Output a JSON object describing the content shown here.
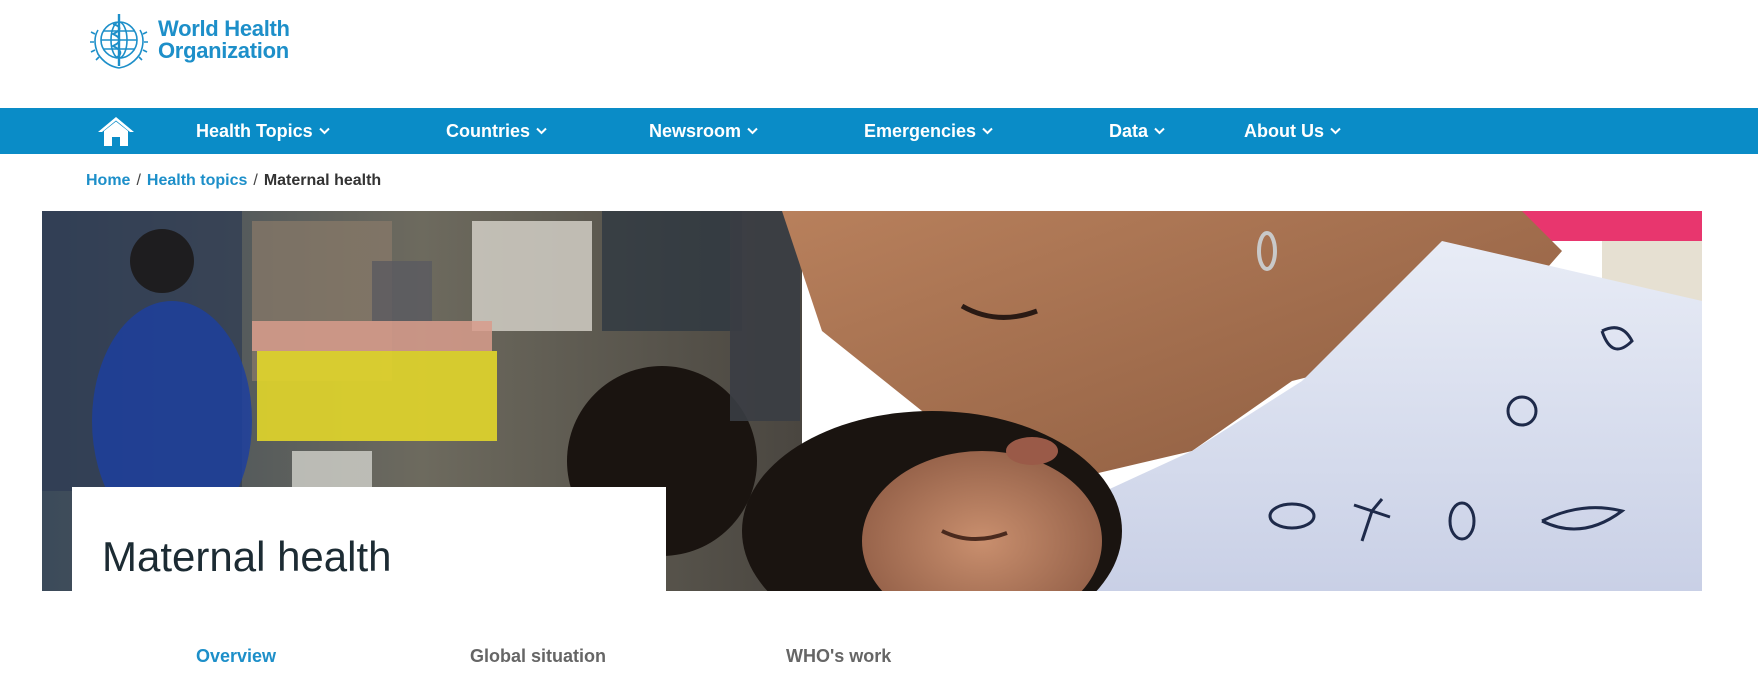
{
  "header": {
    "logo": {
      "line1": "World Health",
      "line2": "Organization",
      "icon": "who-emblem-icon"
    }
  },
  "nav": {
    "home_icon": "home-icon",
    "items": [
      {
        "label": "Health Topics"
      },
      {
        "label": "Countries"
      },
      {
        "label": "Newsroom"
      },
      {
        "label": "Emergencies"
      },
      {
        "label": "Data"
      },
      {
        "label": "About Us"
      }
    ]
  },
  "breadcrumb": {
    "home": "Home",
    "sep": "/",
    "topics": "Health topics",
    "current": "Maternal health"
  },
  "hero": {
    "title": "Maternal health",
    "image_icon": "mother-kissing-newborn-photo"
  },
  "tabs": [
    {
      "label": "Overview",
      "active": true
    },
    {
      "label": "Global situation",
      "active": false
    },
    {
      "label": "WHO's work",
      "active": false
    }
  ],
  "colors": {
    "brand_blue": "#0a8cc7",
    "link_blue": "#1d8fc9",
    "text_dark": "#1c2b33"
  }
}
